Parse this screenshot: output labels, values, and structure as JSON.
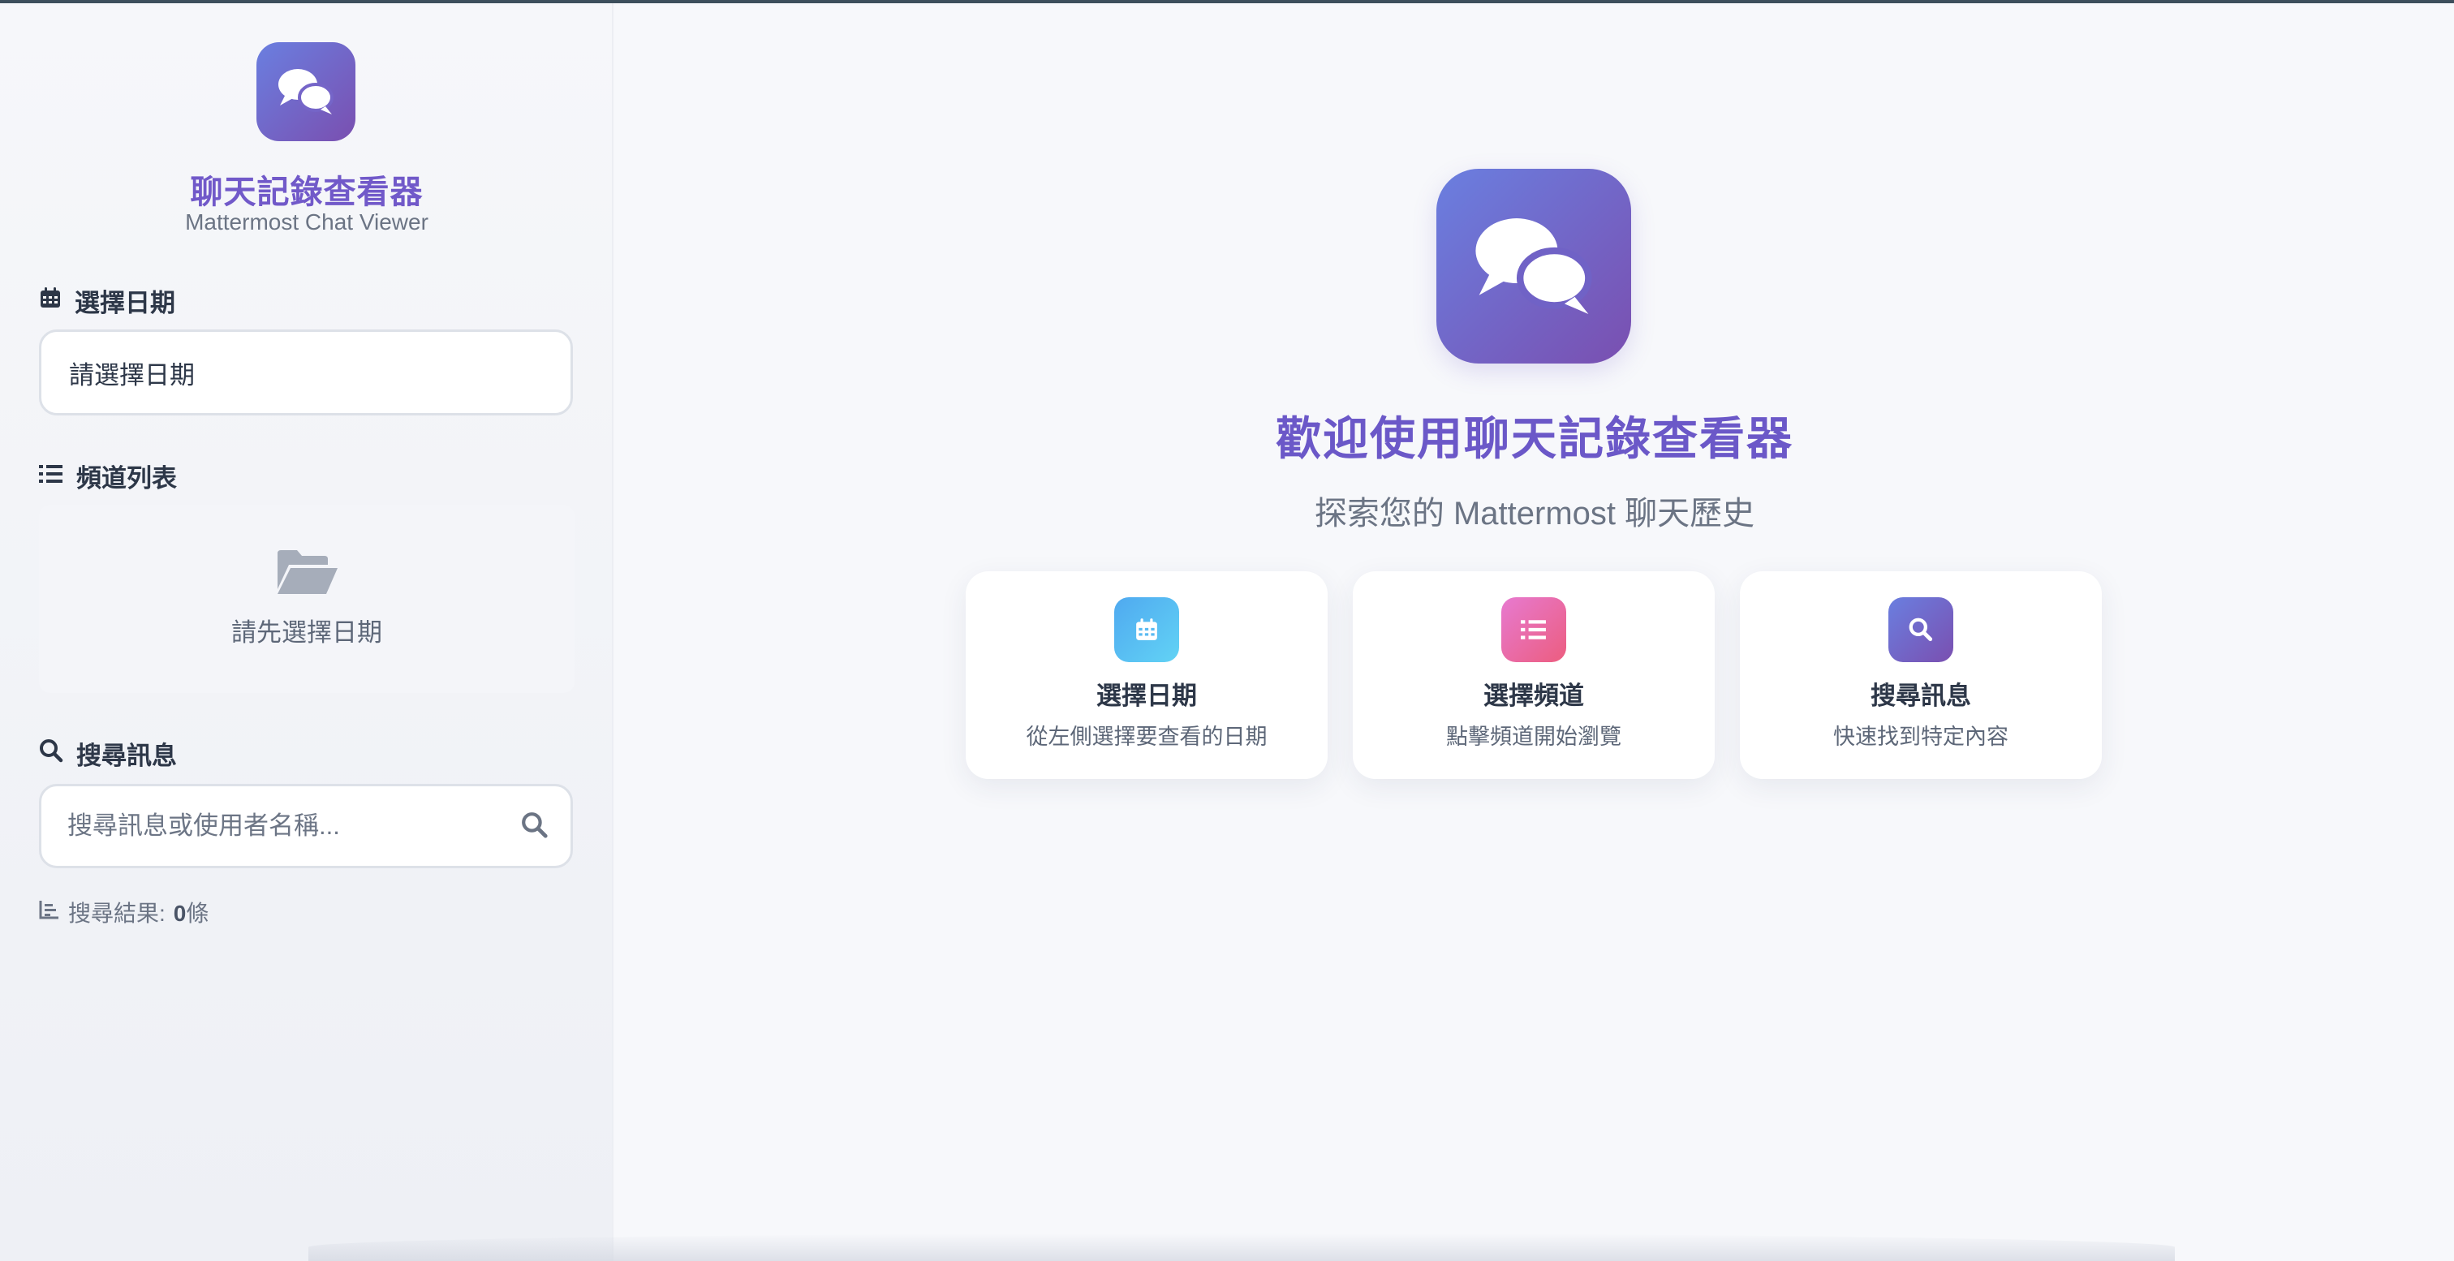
{
  "sidebar": {
    "brand": {
      "title": "聊天記錄查看器",
      "subtitle": "Mattermost Chat Viewer",
      "icon": "chat-bubbles-icon"
    },
    "date_section": {
      "label": "選擇日期",
      "icon": "calendar-icon",
      "input_value": "請選擇日期"
    },
    "channel_section": {
      "label": "頻道列表",
      "icon": "list-icon",
      "empty_icon": "folder-open-icon",
      "empty_text": "請先選擇日期"
    },
    "search_section": {
      "label": "搜尋訊息",
      "icon": "search-icon",
      "placeholder": "搜尋訊息或使用者名稱...",
      "result_label": "搜尋結果:",
      "result_count": "0",
      "result_unit": "條"
    }
  },
  "main": {
    "title": "歡迎使用聊天記錄查看器",
    "subtitle": "探索您的 Mattermost 聊天歷史",
    "cards": [
      {
        "title": "選擇日期",
        "desc": "從左側選擇要查看的日期",
        "icon": "calendar-icon",
        "color_from": "#4fa9f0",
        "color_to": "#62d3f5"
      },
      {
        "title": "選擇頻道",
        "desc": "點擊頻道開始瀏覽",
        "icon": "list-icon",
        "color_from": "#e77ad0",
        "color_to": "#ec5d7f"
      },
      {
        "title": "搜尋訊息",
        "desc": "快速找到特定內容",
        "icon": "search-icon",
        "color_from": "#6a7fe0",
        "color_to": "#7a4fb0"
      }
    ]
  },
  "colors": {
    "accent": "#6b58c8",
    "logo_gradient_from": "#6a7fe0",
    "logo_gradient_to": "#7a4fb0"
  }
}
